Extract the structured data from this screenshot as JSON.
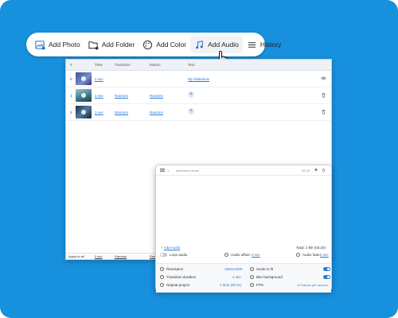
{
  "toolbar": {
    "add_photo": "Add Photo",
    "add_folder": "Add Folder",
    "add_color": "Add Color",
    "add_audio": "Add Audio",
    "history": "History"
  },
  "table": {
    "columns": [
      "#",
      "Time",
      "Transition",
      "Motion",
      "Text"
    ],
    "rows": [
      {
        "num": "0",
        "time": "3 sec",
        "transition": "",
        "motion": "",
        "text": "My slideshow",
        "thumb_color": "#5a6fb5"
      },
      {
        "num": "1",
        "time": "3 sec",
        "transition": "Random",
        "motion": "Random",
        "text": "",
        "thumb_color": "#3e7d8e"
      },
      {
        "num": "2",
        "time": "3 sec",
        "transition": "Random",
        "motion": "Random",
        "text": "",
        "thumb_color": "#2c4a6b"
      }
    ],
    "footer": {
      "apply": "Apply to all",
      "time": "3 sec",
      "transition": "Random",
      "motion": "Rand"
    }
  },
  "audio_panel": {
    "track_name": "adventure music",
    "duration": "04:20",
    "add_audio": "Add Audio",
    "total": "Total: 1 file (04:20)",
    "loop_audio": "Loop audio",
    "audio_offset_label": "Audio offset:",
    "audio_offset_value": "0 sec",
    "audio_fade_label": "Audio fade:",
    "audio_fade_value": "3 sec",
    "settings": {
      "resolution_label": "Resolution",
      "resolution_value": "1920x1080",
      "transition_label": "Transition duration",
      "transition_value": "1 sec",
      "repeat_label": "Repeat project",
      "repeat_value": "1 time (00:11)",
      "scale_label": "Scale to fit",
      "blur_label": "Blur background",
      "fps_label": "FPS",
      "fps_value": "12 frames per second"
    }
  },
  "colors": {
    "background": "#1790dd",
    "accent": "#2b7bd6"
  }
}
